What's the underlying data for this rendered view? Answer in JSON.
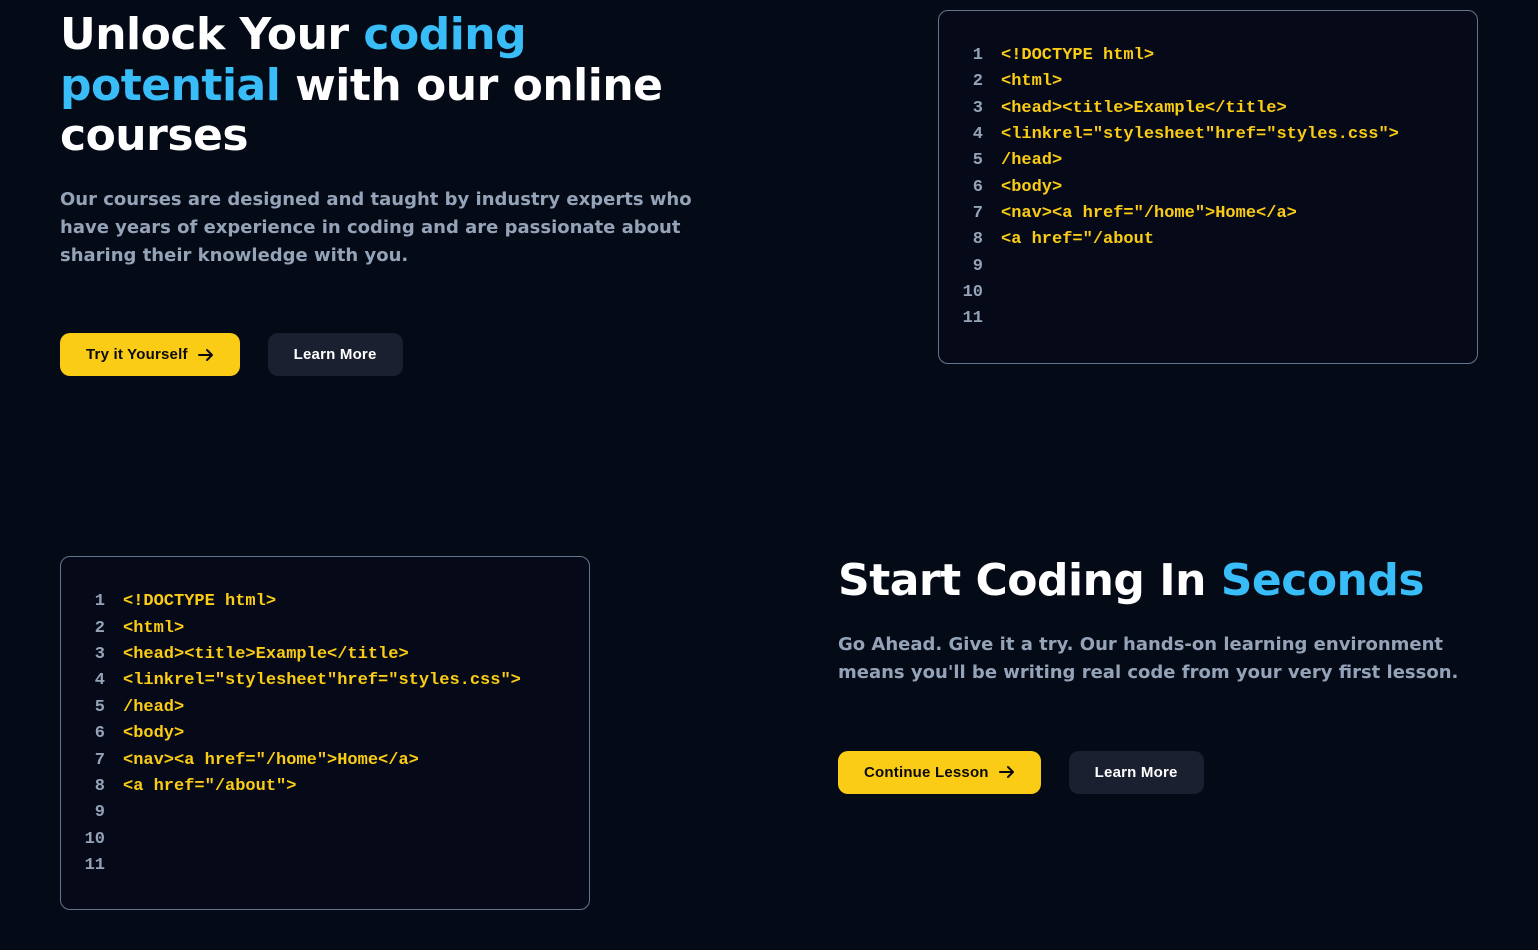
{
  "hero": {
    "title_pre": "Unlock Your ",
    "title_hl": "coding potential",
    "title_post": " with our online courses",
    "sub": "Our courses are designed and taught by industry experts who have years of experience in coding and are passionate about sharing their knowledge with you.",
    "primary_label": "Try it Yourself",
    "secondary_label": "Learn More"
  },
  "start": {
    "title_pre": "Start Coding In ",
    "title_hl": "Seconds",
    "sub": "Go Ahead. Give it a try. Our hands-on learning environment means you'll be writing real code from your very first lesson.",
    "primary_label": "Continue Lesson",
    "secondary_label": "Learn More"
  },
  "code_top": {
    "line_count": 11,
    "lines": [
      "<!DOCTYPE html>",
      "<html>",
      "<head><title>Example</title>",
      "<linkrel=\"stylesheet\"href=\"styles.css\">",
      "/head>",
      "<body>",
      "<nav><a href=\"/home\">Home</a>",
      "<a href=\"/about",
      "",
      "",
      ""
    ]
  },
  "code_bottom": {
    "line_count": 11,
    "lines": [
      "<!DOCTYPE html>",
      "<html>",
      "<head><title>Example</title>",
      "<linkrel=\"stylesheet\"href=\"styles.css\">",
      "/head>",
      "<body>",
      "<nav><a href=\"/home\">Home</a>",
      "<a href=\"/about\">",
      "",
      "",
      ""
    ]
  }
}
